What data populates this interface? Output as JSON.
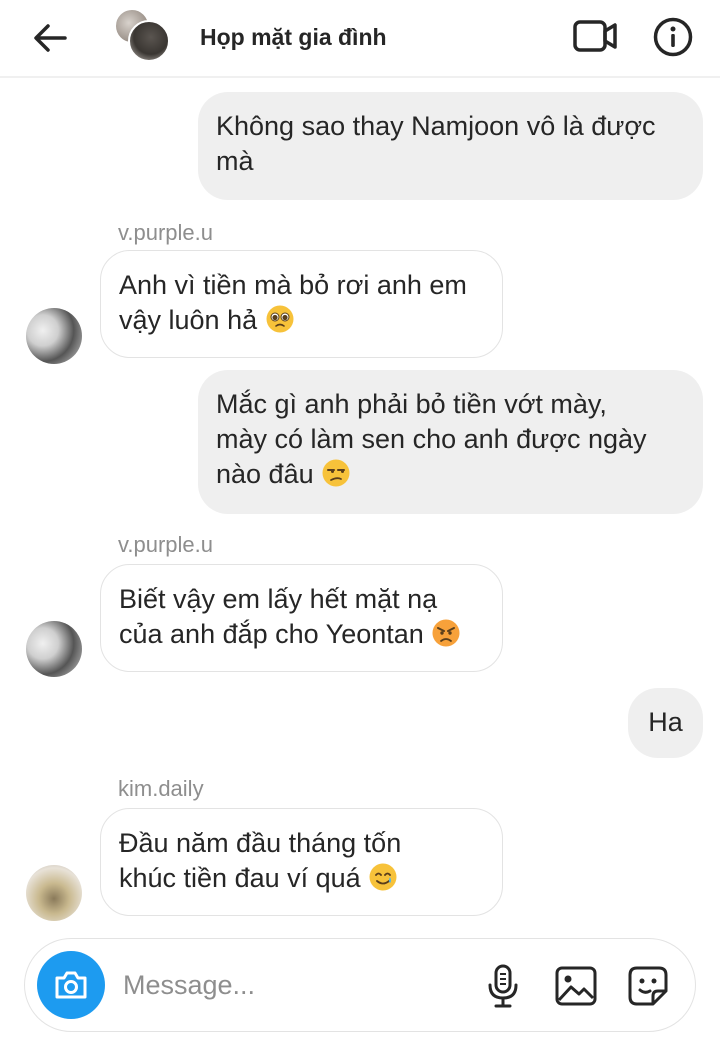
{
  "header": {
    "title": "Họp mặt gia đình",
    "back_icon": "arrow-left-icon",
    "video_icon": "video-camera-icon",
    "info_icon": "info-icon"
  },
  "messages": [
    {
      "direction": "outgoing",
      "lines": [
        "Không sao thay Namjoon vô là được",
        "mà"
      ]
    },
    {
      "direction": "incoming",
      "sender": "v.purple.u",
      "lines": [
        "Anh vì tiền mà bỏ rơi anh em",
        "vậy luôn hả"
      ],
      "emoji": "pleading-face-icon"
    },
    {
      "direction": "outgoing",
      "lines": [
        "Mắc gì anh phải bỏ tiền vớt mày,",
        "mày có làm sen cho anh được ngày",
        "nào đâu"
      ],
      "emoji": "unamused-face-icon"
    },
    {
      "direction": "incoming",
      "sender": "v.purple.u",
      "lines": [
        "Biết vậy em lấy hết mặt nạ",
        "của anh đắp cho Yeontan"
      ],
      "emoji": "angry-face-icon"
    },
    {
      "direction": "outgoing",
      "lines": [
        "Ha"
      ]
    },
    {
      "direction": "incoming",
      "sender": "kim.daily",
      "lines": [
        "Đầu năm đầu tháng tốn",
        "khúc tiền đau ví quá"
      ],
      "emoji": "smiling-face-with-tear-icon"
    }
  ],
  "composer": {
    "placeholder": "Message...",
    "camera_icon": "camera-icon",
    "mic_icon": "microphone-icon",
    "gallery_icon": "gallery-icon",
    "sticker_icon": "sticker-icon"
  },
  "colors": {
    "outgoing_bubble": "#efefef",
    "incoming_border": "#e3e3e3",
    "camera_button": "#1d9bf0",
    "sender_text": "#8e8e8e",
    "emoji_yellow": "#f7c23a"
  }
}
